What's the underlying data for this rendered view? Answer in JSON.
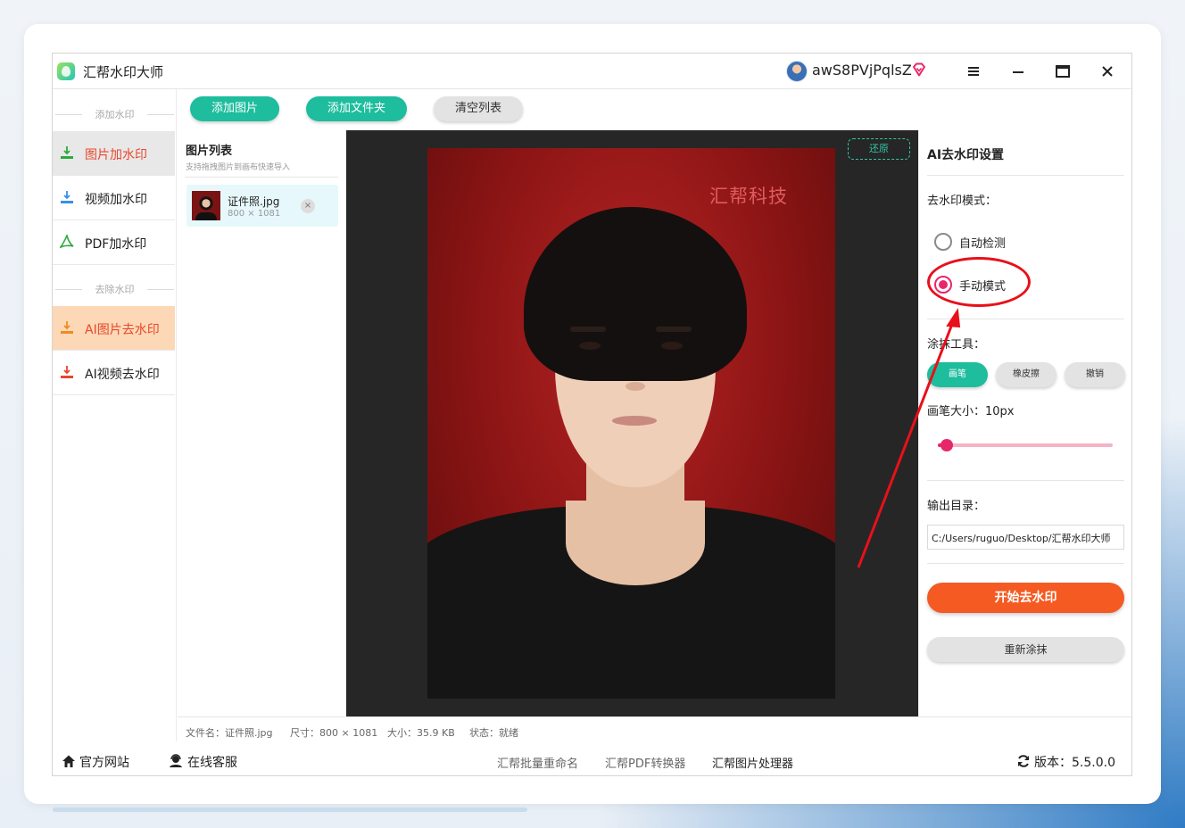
{
  "window": {
    "app_title": "汇帮水印大师",
    "username": "awS8PVjPqlsZ"
  },
  "sidebar": {
    "section_add": "添加水印",
    "section_remove": "去除水印",
    "items": [
      {
        "label": "图片加水印",
        "icon": "image-watermark-icon",
        "color": "#2eaa3c"
      },
      {
        "label": "视频加水印",
        "icon": "video-watermark-icon",
        "color": "#3a8ee6"
      },
      {
        "label": "PDF加水印",
        "icon": "pdf-icon",
        "color": "#2eaa3c"
      },
      {
        "label": "AI图片去水印",
        "icon": "ai-image-remove-icon",
        "color": "#f08a24"
      },
      {
        "label": "AI视频去水印",
        "icon": "ai-video-remove-icon",
        "color": "#e8472c"
      }
    ]
  },
  "toolbar": {
    "add_image": "添加图片",
    "add_folder": "添加文件夹",
    "clear_list": "清空列表"
  },
  "image_list": {
    "title": "图片列表",
    "subtitle": "支持拖拽图片到画布快速导入",
    "items": [
      {
        "name": "证件照.jpg",
        "dims": "800 × 1081",
        "remove": "×"
      }
    ]
  },
  "preview": {
    "restore_label": "还原",
    "watermark_text": "汇帮科技"
  },
  "status": {
    "filename": "文件名：证件照.jpg",
    "size_dims": "尺寸：800 × 1081",
    "filesize": "大小：35.9 KB",
    "state": "状态：就绪"
  },
  "settings": {
    "title": "AI去水印设置",
    "mode_label": "去水印模式：",
    "mode_options": [
      "自动检测",
      "手动模式"
    ],
    "mode_selected": "手动模式",
    "tool_label": "涂抹工具：",
    "tools": [
      "画笔",
      "橡皮擦",
      "撤销"
    ],
    "tool_selected": "画笔",
    "brush_size_label": "画笔大小：",
    "brush_size_value": "10px",
    "brush_slider_fraction": 0.05,
    "output_label": "输出目录：",
    "output_path": "C:/Users/ruguo/Desktop/汇帮水印大师",
    "start_button": "开始去水印",
    "redo_button": "重新涂抹"
  },
  "footer": {
    "official_site": "官方网站",
    "online_support": "在线客服",
    "links": [
      "汇帮批量重命名",
      "汇帮PDF转换器",
      "汇帮图片处理器"
    ],
    "version": "版本：5.5.0.0"
  },
  "colors": {
    "accent_teal": "#1dbd9e",
    "accent_orange": "#f45a22",
    "accent_pink": "#e8276b",
    "annotation_red": "#e8101a"
  }
}
